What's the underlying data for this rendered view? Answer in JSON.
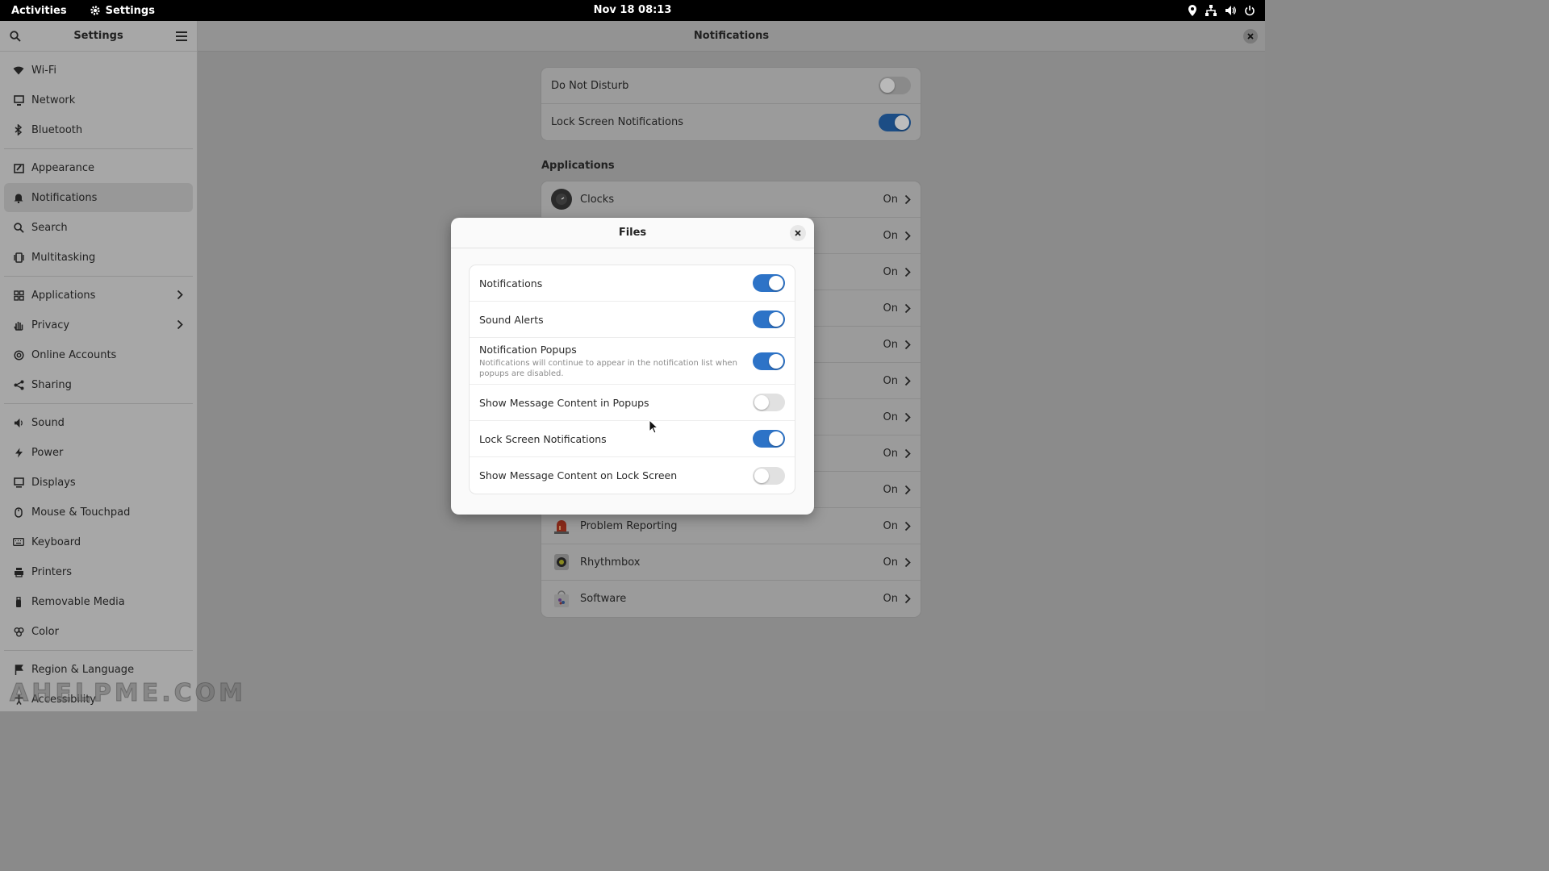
{
  "topbar": {
    "activities": "Activities",
    "app_name": "Settings",
    "clock": "Nov 18  08:13"
  },
  "sidebar": {
    "title": "Settings",
    "items": [
      {
        "label": "Wi-Fi",
        "icon": "wifi-icon"
      },
      {
        "label": "Network",
        "icon": "network-icon"
      },
      {
        "label": "Bluetooth",
        "icon": "bluetooth-icon"
      },
      {
        "label": "Appearance",
        "icon": "appearance-icon"
      },
      {
        "label": "Notifications",
        "icon": "bell-icon",
        "active": true
      },
      {
        "label": "Search",
        "icon": "search-icon"
      },
      {
        "label": "Multitasking",
        "icon": "multitasking-icon"
      },
      {
        "label": "Applications",
        "icon": "grid-icon"
      },
      {
        "label": "Privacy",
        "icon": "hand-icon"
      },
      {
        "label": "Online Accounts",
        "icon": "at-icon"
      },
      {
        "label": "Sharing",
        "icon": "share-icon"
      },
      {
        "label": "Sound",
        "icon": "speaker-icon"
      },
      {
        "label": "Power",
        "icon": "battery-icon"
      },
      {
        "label": "Displays",
        "icon": "display-icon"
      },
      {
        "label": "Mouse & Touchpad",
        "icon": "mouse-icon"
      },
      {
        "label": "Keyboard",
        "icon": "keyboard-icon"
      },
      {
        "label": "Printers",
        "icon": "printer-icon"
      },
      {
        "label": "Removable Media",
        "icon": "usb-icon"
      },
      {
        "label": "Color",
        "icon": "color-icon"
      },
      {
        "label": "Region & Language",
        "icon": "flag-icon"
      },
      {
        "label": "Accessibility",
        "icon": "accessibility-icon"
      }
    ]
  },
  "content": {
    "title": "Notifications",
    "global": {
      "dnd_label": "Do Not Disturb",
      "dnd_on": false,
      "lock_label": "Lock Screen Notifications",
      "lock_on": true
    },
    "applications_title": "Applications",
    "apps": [
      {
        "name": "Clocks",
        "state": "On"
      },
      {
        "name": "",
        "state": "On"
      },
      {
        "name": "",
        "state": "On"
      },
      {
        "name": "",
        "state": "On"
      },
      {
        "name": "",
        "state": "On"
      },
      {
        "name": "",
        "state": "On"
      },
      {
        "name": "",
        "state": "On"
      },
      {
        "name": "",
        "state": "On"
      },
      {
        "name": "",
        "state": "On"
      },
      {
        "name": "Problem Reporting",
        "state": "On"
      },
      {
        "name": "Rhythmbox",
        "state": "On"
      },
      {
        "name": "Software",
        "state": "On"
      }
    ]
  },
  "dialog": {
    "title": "Files",
    "rows": [
      {
        "label": "Notifications",
        "on": true
      },
      {
        "label": "Sound Alerts",
        "on": true
      },
      {
        "label": "Notification Popups",
        "sub": "Notifications will continue to appear in the notification list when popups are disabled.",
        "on": true
      },
      {
        "label": "Show Message Content in Popups",
        "on": false
      },
      {
        "label": "Lock Screen Notifications",
        "on": true
      },
      {
        "label": "Show Message Content on Lock Screen",
        "on": false
      }
    ]
  },
  "watermark": "AHELPME.COM",
  "colors": {
    "accent": "#2d73c7",
    "topbar": "#000000"
  }
}
